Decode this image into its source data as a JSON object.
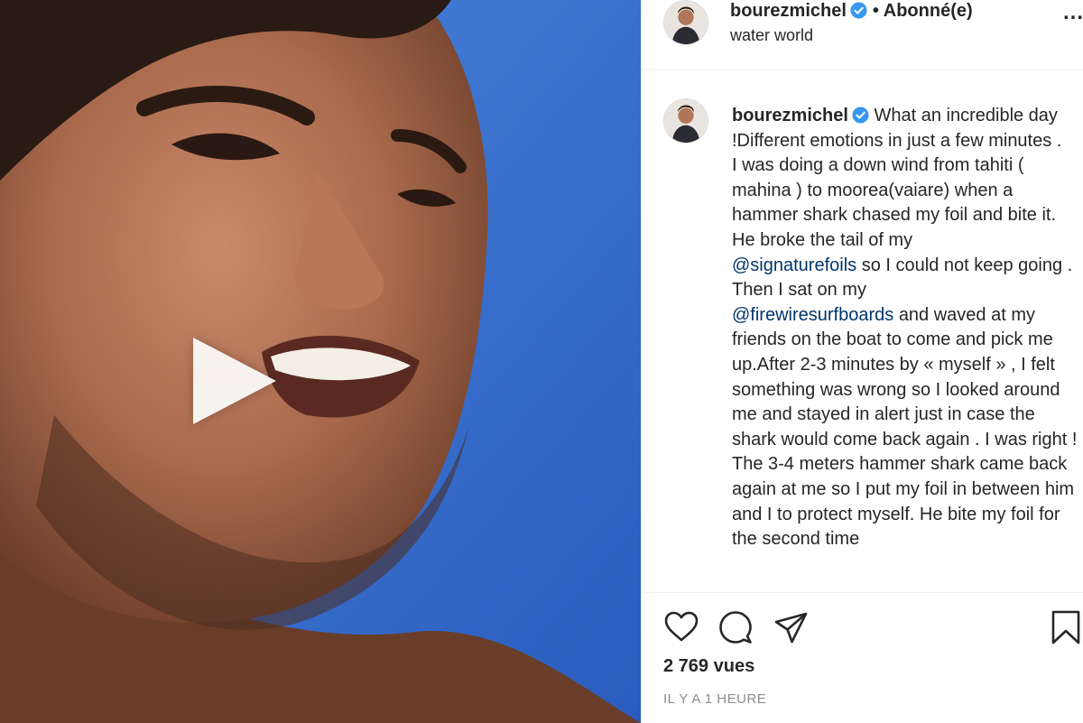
{
  "media": {
    "type": "video",
    "play_icon": "play-icon"
  },
  "header": {
    "username": "bourezmichel",
    "verified_icon": "verified-badge-icon",
    "separator": "•",
    "follow_status": "Abonné(e)",
    "location": "water world",
    "more_icon": "more-options-icon",
    "more_label": "..."
  },
  "caption": {
    "username": "bourezmichel",
    "segments": {
      "s1": "What an incredible day !Different emotions in just a few minutes .",
      "s2": "I was doing a down wind from tahiti ( mahina ) to moorea(vaiare) when a hammer shark chased my foil and bite it. He broke the tail of my",
      "m1": "@signaturefoils",
      "s3": "so I could not keep going . Then I sat on my",
      "m2": "@firewiresurfboards",
      "s4": "and waved at my friends on the boat to come and pick me up.After 2-3 minutes by « myself » , I felt something was wrong so I looked around me and stayed in alert just in case the shark would come back again . I was right !",
      "s5": "The 3-4 meters hammer shark came back again at me so I put my foil in between him and I to protect myself. He bite my foil for the second time"
    }
  },
  "actions": {
    "like_icon": "heart-icon",
    "comment_icon": "comment-icon",
    "share_icon": "share-icon",
    "save_icon": "bookmark-icon",
    "views": "2 769 vues",
    "timestamp": "IL Y A 1 HEURE"
  },
  "colors": {
    "verified": "#3897f0",
    "mention": "#003569",
    "muted": "#8e8e8e",
    "sky": "#2f66c8"
  }
}
